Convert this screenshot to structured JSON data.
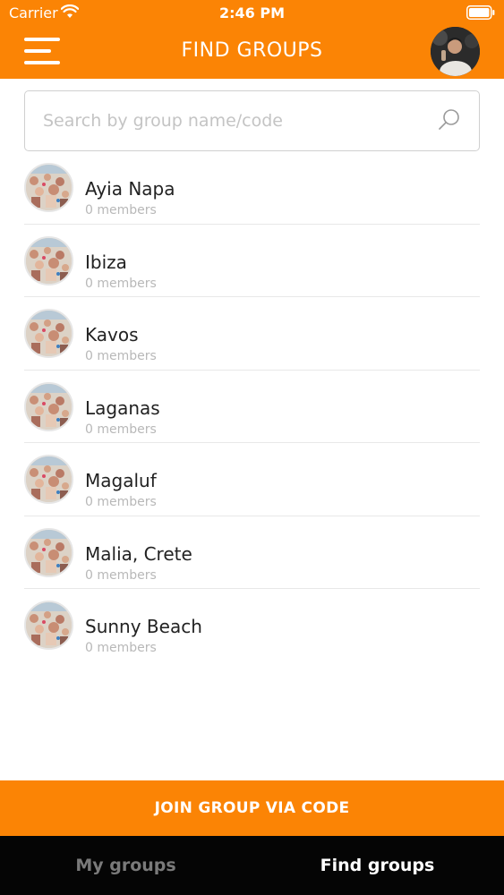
{
  "status_bar": {
    "carrier": "Carrier",
    "time": "2:46 PM"
  },
  "header": {
    "title": "FIND GROUPS"
  },
  "search": {
    "placeholder": "Search by group name/code"
  },
  "groups": [
    {
      "name": "Ayia Napa",
      "members": "0 members"
    },
    {
      "name": "Ibiza",
      "members": "0 members"
    },
    {
      "name": "Kavos",
      "members": "0 members"
    },
    {
      "name": "Laganas",
      "members": "0 members"
    },
    {
      "name": "Magaluf",
      "members": "0 members"
    },
    {
      "name": "Malia, Crete",
      "members": "0 members"
    },
    {
      "name": "Sunny Beach",
      "members": "0 members"
    }
  ],
  "join_button": {
    "label": "JOIN GROUP VIA CODE"
  },
  "tabs": [
    {
      "label": "My groups",
      "active": false
    },
    {
      "label": "Find groups",
      "active": true
    }
  ],
  "colors": {
    "accent": "#fb8405",
    "tab_bar": "#050505",
    "tab_inactive": "#7a7a7a",
    "tab_active": "#ffffff"
  }
}
